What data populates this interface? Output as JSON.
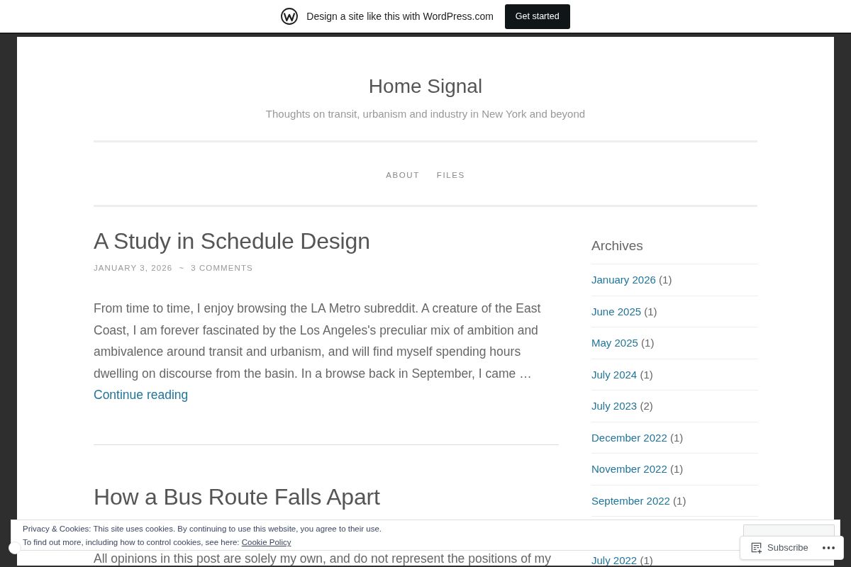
{
  "top_bar": {
    "text": "Design a site like this with WordPress.com",
    "button": "Get started"
  },
  "site": {
    "title": "Home Signal",
    "tagline": "Thoughts on transit, urbanism and industry in New York and beyond"
  },
  "nav": [
    "ABOUT",
    "FILES"
  ],
  "posts": [
    {
      "title": "A Study in Schedule Design",
      "date": "JANUARY 3, 2026",
      "separator": "~",
      "comments": "3 COMMENTS",
      "excerpt": "From time to time, I enjoy browsing the LA Metro subreddit. A creature of the East Coast, I am forever fascinated by the Los Angeles's preculiar mix of ambition and ambivalence around transit and urbanism, and will find myself spending hours dwelling on discourse from the basin. In a browse back in September, I came …",
      "more_link": "Continue reading"
    },
    {
      "title": "How a Bus Route Falls Apart",
      "excerpt": "All opinions in this post are solely my own, and do not represent the positions of my"
    }
  ],
  "archives": {
    "title": "Archives",
    "items": [
      {
        "label": "January 2026",
        "count": "(1)"
      },
      {
        "label": "June 2025",
        "count": "(1)"
      },
      {
        "label": "May 2025",
        "count": "(1)"
      },
      {
        "label": "July 2024",
        "count": "(1)"
      },
      {
        "label": "July 2023",
        "count": "(2)"
      },
      {
        "label": "December 2022",
        "count": "(1)"
      },
      {
        "label": "November 2022",
        "count": "(1)"
      },
      {
        "label": "September 2022",
        "count": "(1)"
      }
    ],
    "items_below_banner": [
      {
        "label": "July 2022",
        "count": "(1)"
      }
    ]
  },
  "cookie_banner": {
    "line_1": "Privacy & Cookies: This site uses cookies. By continuing to use this website, you agree to their use.",
    "line_2": "To find out more, including how to control cookies, see here:",
    "link": "Cookie Policy"
  },
  "subscribe_bar": {
    "label": "Subscribe"
  }
}
